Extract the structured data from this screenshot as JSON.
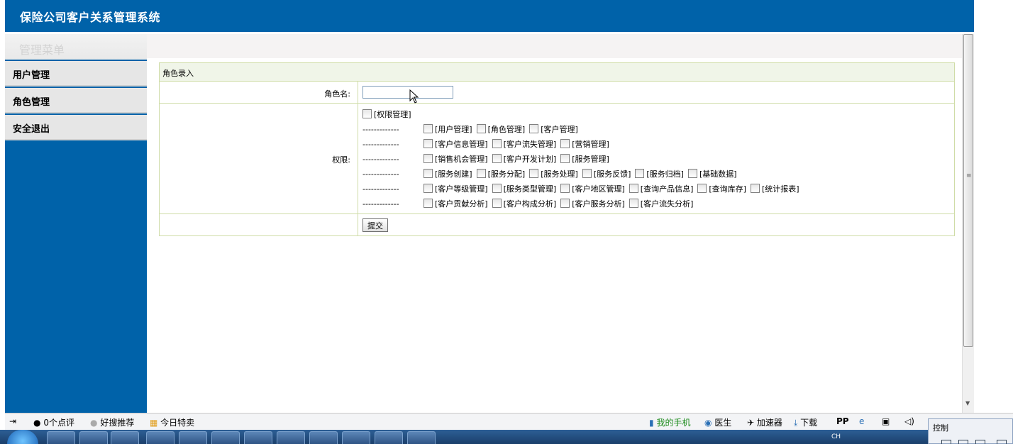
{
  "header": {
    "title": "保险公司客户关系管理系统"
  },
  "sidebar": {
    "heading": "管理菜单",
    "items": [
      {
        "label": "用户管理"
      },
      {
        "label": "角色管理"
      },
      {
        "label": "安全退出"
      }
    ]
  },
  "form": {
    "section_title": "角色录入",
    "role_name_label": "角色名:",
    "role_name_value": "",
    "permissions_label": "权限:",
    "submit_label": "提交",
    "dash": "-------------",
    "root_permission": "[权限管理]",
    "permission_rows": [
      [
        "[用户管理]",
        "[角色管理]",
        "[客户管理]"
      ],
      [
        "[客户信息管理]",
        "[客户流失管理]",
        "[营销管理]"
      ],
      [
        "[销售机会管理]",
        "[客户开发计划]",
        "[服务管理]"
      ],
      [
        "[服务创建]",
        "[服务分配]",
        "[服务处理]",
        "[服务反馈]",
        "[服务归档]",
        "[基础数据]"
      ],
      [
        "[客户等级管理]",
        "[服务类型管理]",
        "[客户地区管理]",
        "[查询产品信息]",
        "[查询库存]",
        "[统计报表]"
      ],
      [
        "[客户贡献分析]",
        "[客户构成分析]",
        "[客户服务分析]",
        "[客户流失分析]"
      ]
    ]
  },
  "statusbar": {
    "reviews": "0个点评",
    "recommend": "好搜推荐",
    "deals": "今日特卖",
    "my_phone": "我的手机",
    "doctor": "医生",
    "accelerator": "加速器",
    "download": "下载"
  },
  "taskbar": {
    "tray_text": "CH"
  },
  "control_panel": {
    "label": "控制"
  },
  "colors": {
    "header_bg": "#0062a9",
    "sidebar_bg": "#0062a9",
    "frame_border": "#cfdca7"
  }
}
